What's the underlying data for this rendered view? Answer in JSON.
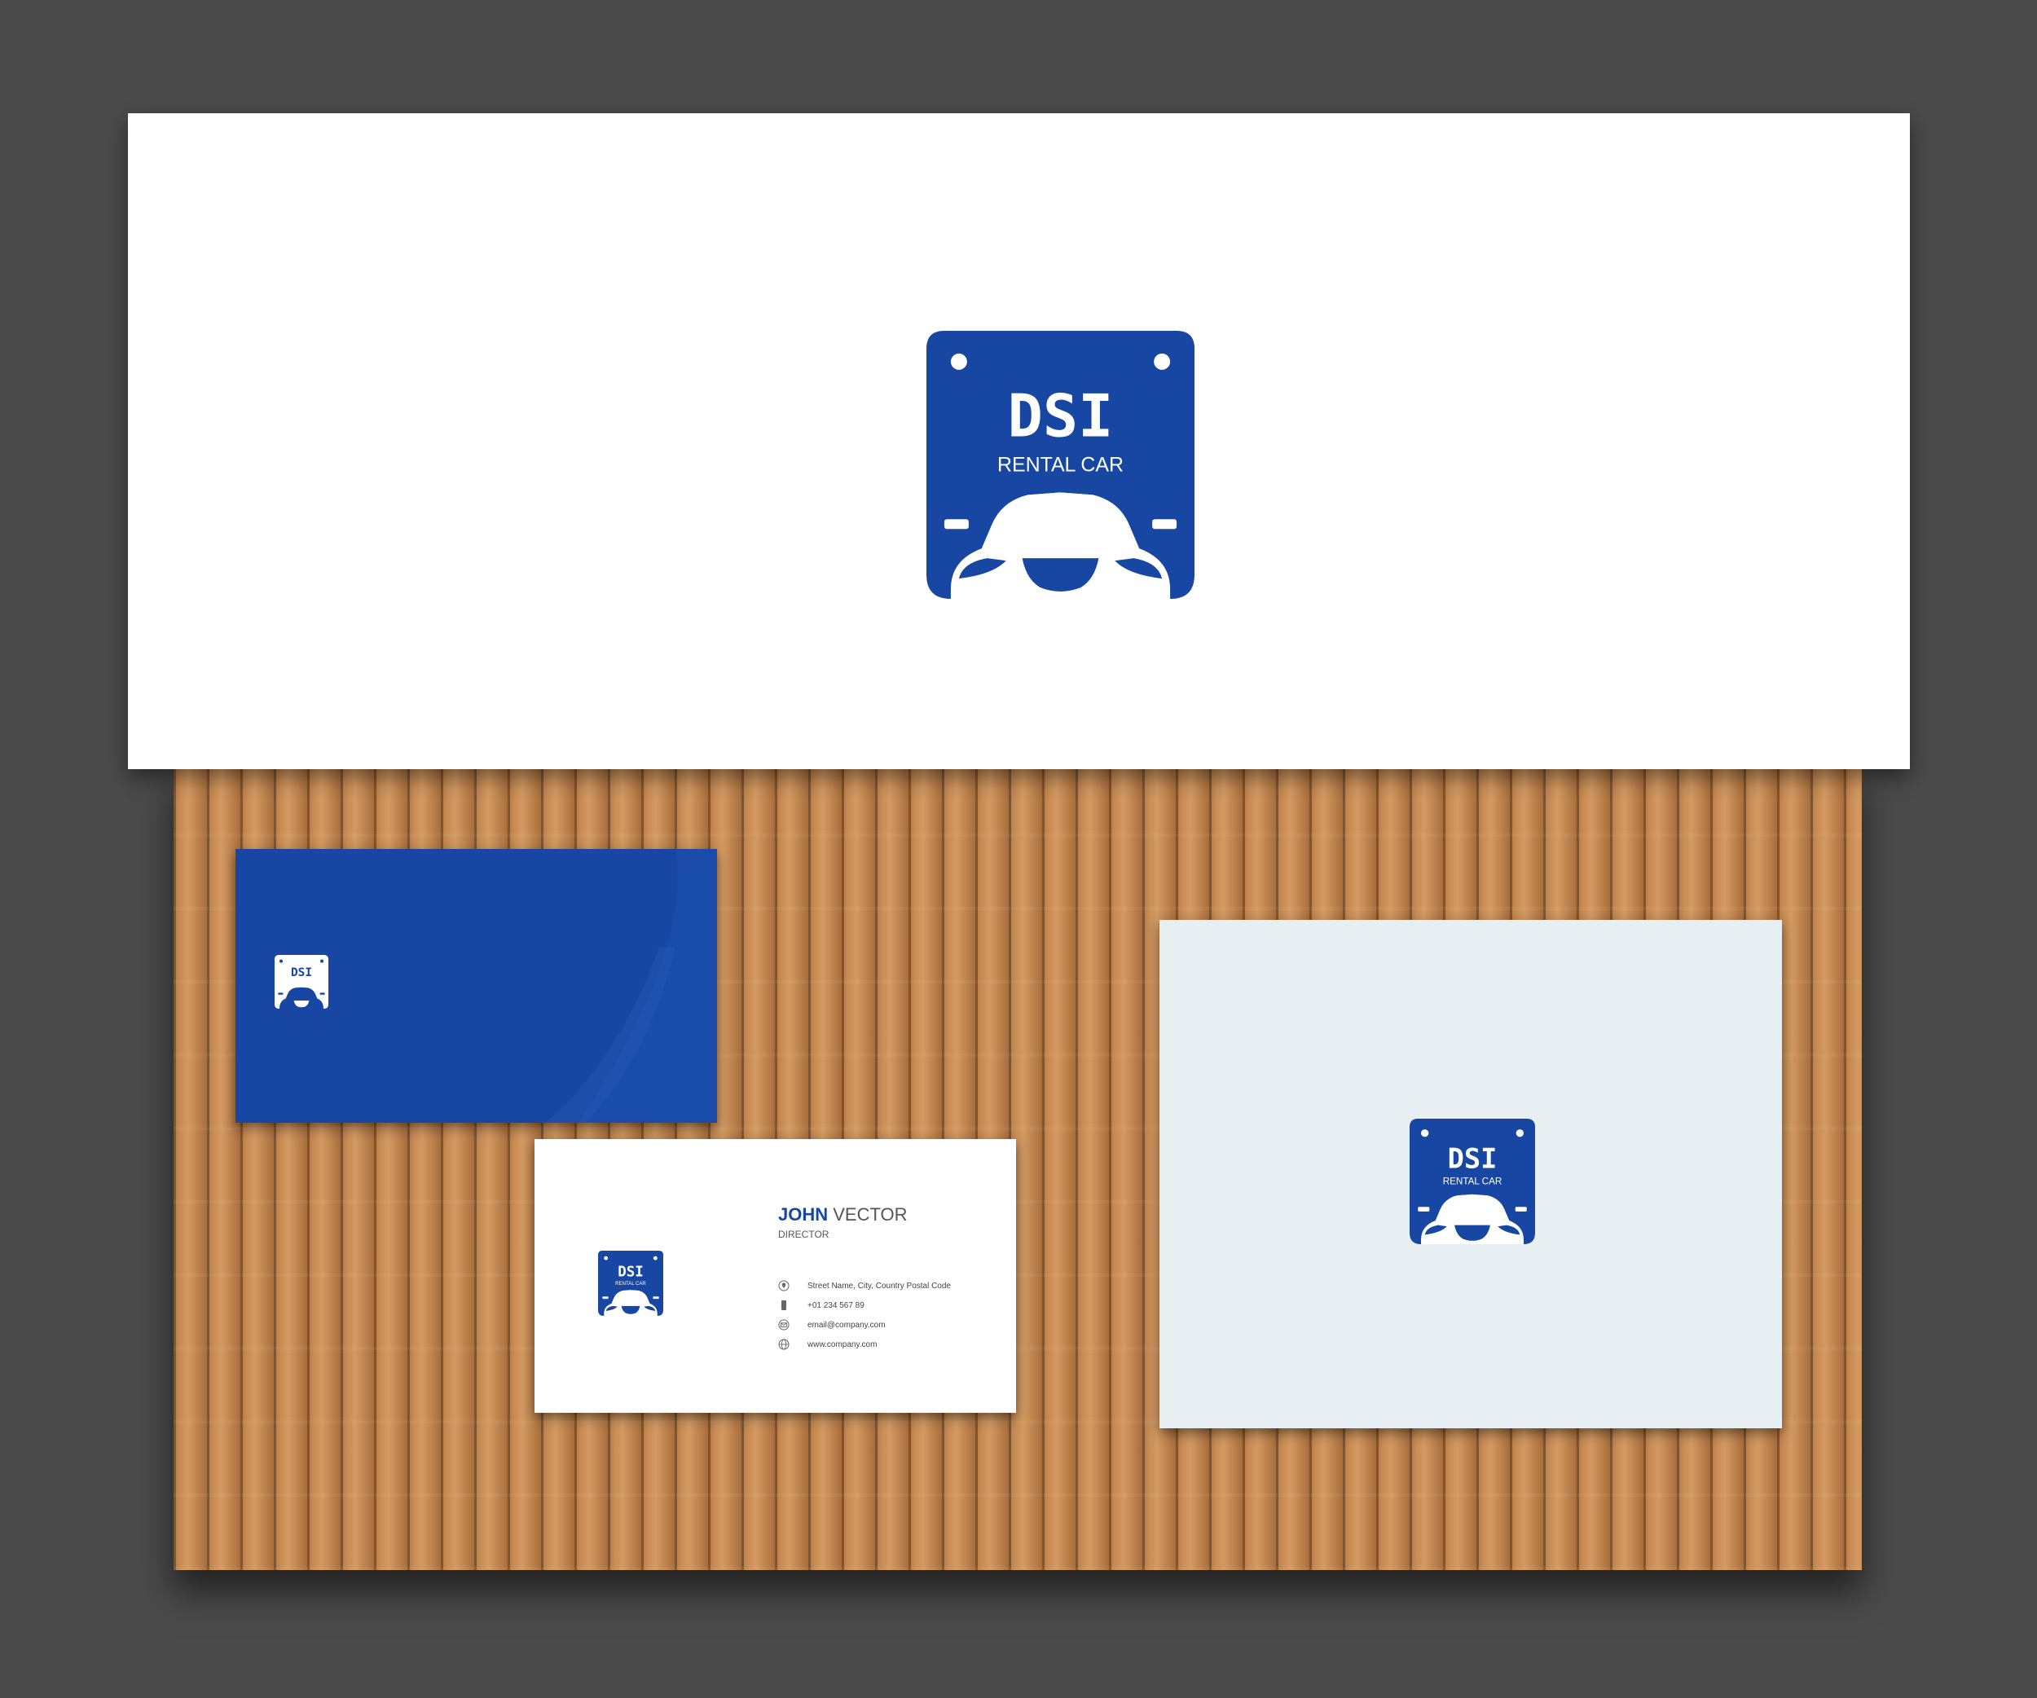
{
  "brand": {
    "name": "DSI",
    "tagline": "RENTAL CAR",
    "color": "#1747a2"
  },
  "business_card": {
    "first_name": "JOHN",
    "last_name": "VECTOR",
    "title": "DIRECTOR",
    "contacts": [
      {
        "icon": "location-pin-icon",
        "text": "Street Name, City, Country Postal Code"
      },
      {
        "icon": "mobile-phone-icon",
        "text": "+01 234 567 89"
      },
      {
        "icon": "email-icon",
        "text": "email@company.com"
      },
      {
        "icon": "globe-icon",
        "text": "www.company.com"
      }
    ]
  }
}
